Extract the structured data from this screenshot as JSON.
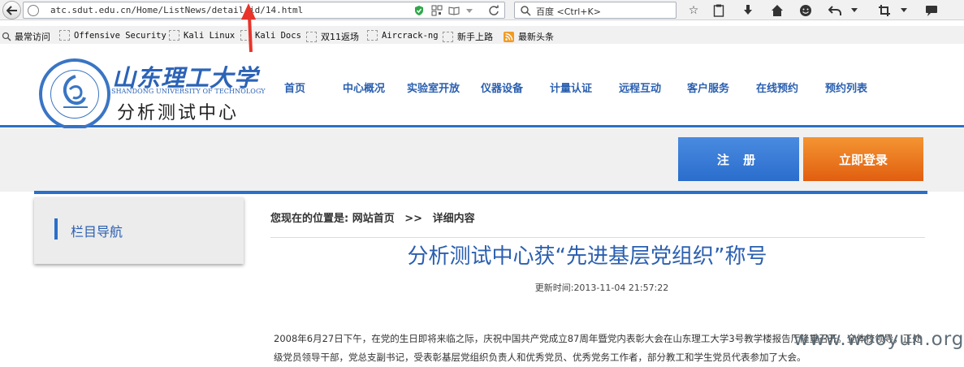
{
  "browser": {
    "url": "atc.sdut.edu.cn/Home/ListNews/detail/id/14.html",
    "search_placeholder": "百度 <Ctrl+K>"
  },
  "bookmarks": [
    "最常访问",
    "Offensive Security",
    "Kali Linux",
    "Kali Docs",
    "双11返场",
    "Aircrack-ng",
    "新手上路",
    "最新头条"
  ],
  "site": {
    "logo_cn": "山东理工大学",
    "logo_en": "SHANDONG UNIVERSITY OF TECHNOLOGY",
    "logo_center": "分析测试中心",
    "nav": [
      "首页",
      "中心概况",
      "实验室开放",
      "仪器设备",
      "计量认证",
      "远程互动",
      "客户服务",
      "在线预约",
      "预约列表"
    ],
    "register_label": "注 册",
    "login_label": "立即登录",
    "sidebar_title": "栏目导航"
  },
  "article": {
    "crumb_prefix": "您现在的位置是:",
    "crumb_home": "网站首页",
    "crumb_sep": ">>",
    "crumb_current": "详细内容",
    "title": "分析测试中心获“先进基层党组织”称号",
    "updated_label": "更新时间:",
    "updated_value": "2013-11-04 21:57:22",
    "body": "2008年6月27日下午，在党的生日即将来临之际，庆祝中国共产党成立87周年暨党内表彰大会在山东理工大学3号教学楼报告厅隆重召开。全体校领导，正处级党员领导干部，党总支副书记，受表彰基层党组织负责人和优秀党员、优秀党务工作者，部分教工和学生党员代表参加了大会。"
  },
  "watermark": "www.wooyun.org"
}
